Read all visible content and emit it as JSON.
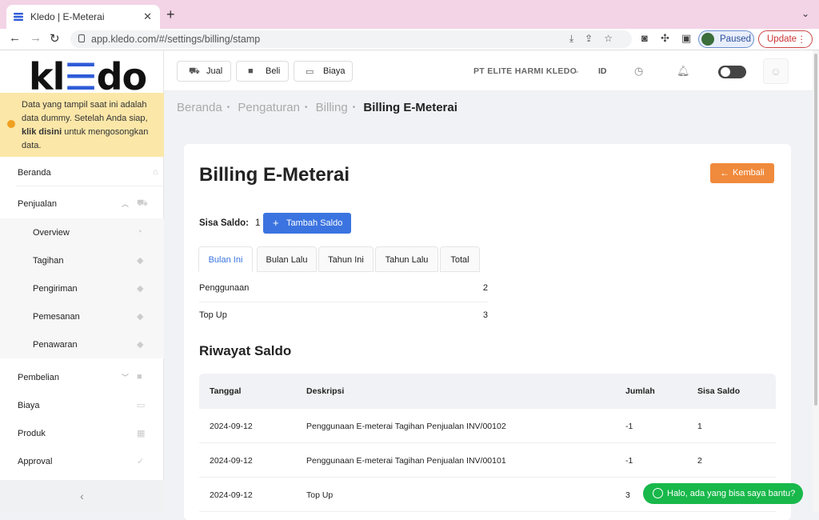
{
  "browser": {
    "tab_title": "Kledo | E-Meterai",
    "tab_close": "✕",
    "new_tab": "+",
    "url": "app.kledo.com/#/settings/billing/stamp",
    "profile_label": "Paused",
    "update_label": "Update"
  },
  "sidebar": {
    "logo_text": [
      "kl",
      "d",
      "o"
    ],
    "notice": {
      "text_before": "Data yang tampil saat ini adalah data dummy. Setelah Anda siap, ",
      "link": "klik disini",
      "text_after": " untuk mengosongkan data."
    },
    "items": [
      {
        "label": "Beranda"
      },
      {
        "label": "Penjualan"
      },
      {
        "label": "Overview"
      },
      {
        "label": "Tagihan"
      },
      {
        "label": "Pengiriman"
      },
      {
        "label": "Pemesanan"
      },
      {
        "label": "Penawaran"
      },
      {
        "label": "Pembelian"
      },
      {
        "label": "Biaya"
      },
      {
        "label": "Produk"
      },
      {
        "label": "Approval"
      }
    ],
    "collapse_icon": "‹"
  },
  "topbar": {
    "jual": "Jual",
    "beli": "Beli",
    "biaya": "Biaya",
    "company": "PT ELITE HARMI KLEDO",
    "language": "ID"
  },
  "breadcrumb": {
    "home": "Beranda",
    "settings": "Pengaturan",
    "billing": "Billing",
    "current": "Billing E-Meterai"
  },
  "page": {
    "title": "Billing E-Meterai",
    "back_label": "Kembali",
    "saldo_label": "Sisa Saldo:",
    "saldo_value": "1",
    "add_saldo_label": "Tambah Saldo",
    "tabs": [
      "Bulan Ini",
      "Bulan Lalu",
      "Tahun Ini",
      "Tahun Lalu",
      "Total"
    ],
    "stats": [
      {
        "label": "Penggunaan",
        "value": "2"
      },
      {
        "label": "Top Up",
        "value": "3"
      }
    ],
    "history_title": "Riwayat Saldo",
    "table": {
      "headers": [
        "Tanggal",
        "Deskripsi",
        "Jumlah",
        "Sisa Saldo"
      ],
      "rows": [
        [
          "2024-09-12",
          "Penggunaan E-meterai Tagihan Penjualan INV/00102",
          "-1",
          "1"
        ],
        [
          "2024-09-12",
          "Penggunaan E-meterai Tagihan Penjualan INV/00101",
          "-1",
          "2"
        ],
        [
          "2024-09-12",
          "Top Up",
          "3",
          ""
        ]
      ]
    }
  },
  "chat_widget": {
    "label": "Halo, ada yang bisa saya bantu?"
  },
  "colors": {
    "primary": "#3b74e0",
    "orange": "#f08a3c",
    "notice": "#fbe7a8",
    "whatsapp": "#18b84a"
  }
}
